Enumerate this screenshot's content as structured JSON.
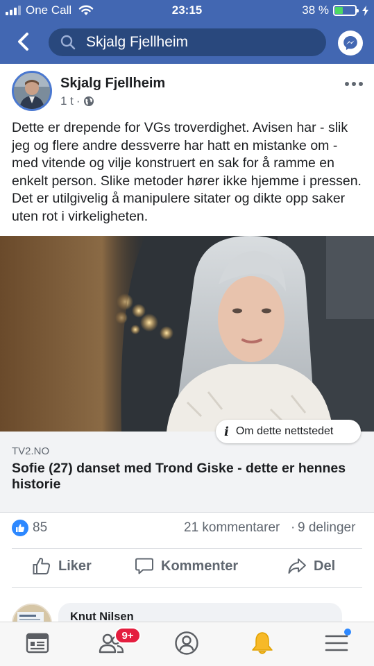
{
  "status_bar": {
    "carrier": "One Call",
    "time": "23:15",
    "battery_percent": "38 %",
    "battery_level": 0.38
  },
  "header": {
    "search_value": "Skjalg Fjellheim",
    "back_icon": "back-chevron-icon",
    "messenger_icon": "messenger-icon"
  },
  "post": {
    "author": "Skjalg Fjellheim",
    "time": "1 t",
    "audience_icon": "globe-icon",
    "text": "Dette er drepende for VGs troverdighet. Avisen har - slik jeg og flere andre dessverre har hatt en mistanke om - med vitende og vilje konstruert en sak for å ramme en enkelt person. Slike metoder hører ikke hjemme i pressen. Det er utilgivelig å manipulere sitater og dikte opp saker uten rot i virkeligheten."
  },
  "link_preview": {
    "about_label": "Om dette nettstedet",
    "domain": "TV2.NO",
    "title": "Sofie (27) danset med Trond Giske - dette er hennes historie"
  },
  "reactions": {
    "likes": "85",
    "comments": "21 kommentarer",
    "separator": "·",
    "shares": "9 delinger"
  },
  "actions": {
    "like": "Liker",
    "comment": "Kommenter",
    "share": "Del"
  },
  "comment_preview": {
    "name": "Knut Nilsen"
  },
  "tabbar": {
    "friends_badge": "9+"
  },
  "colors": {
    "brand": "#4267b2",
    "like_blue": "#2d88ff",
    "badge_red": "#e41e3f"
  }
}
